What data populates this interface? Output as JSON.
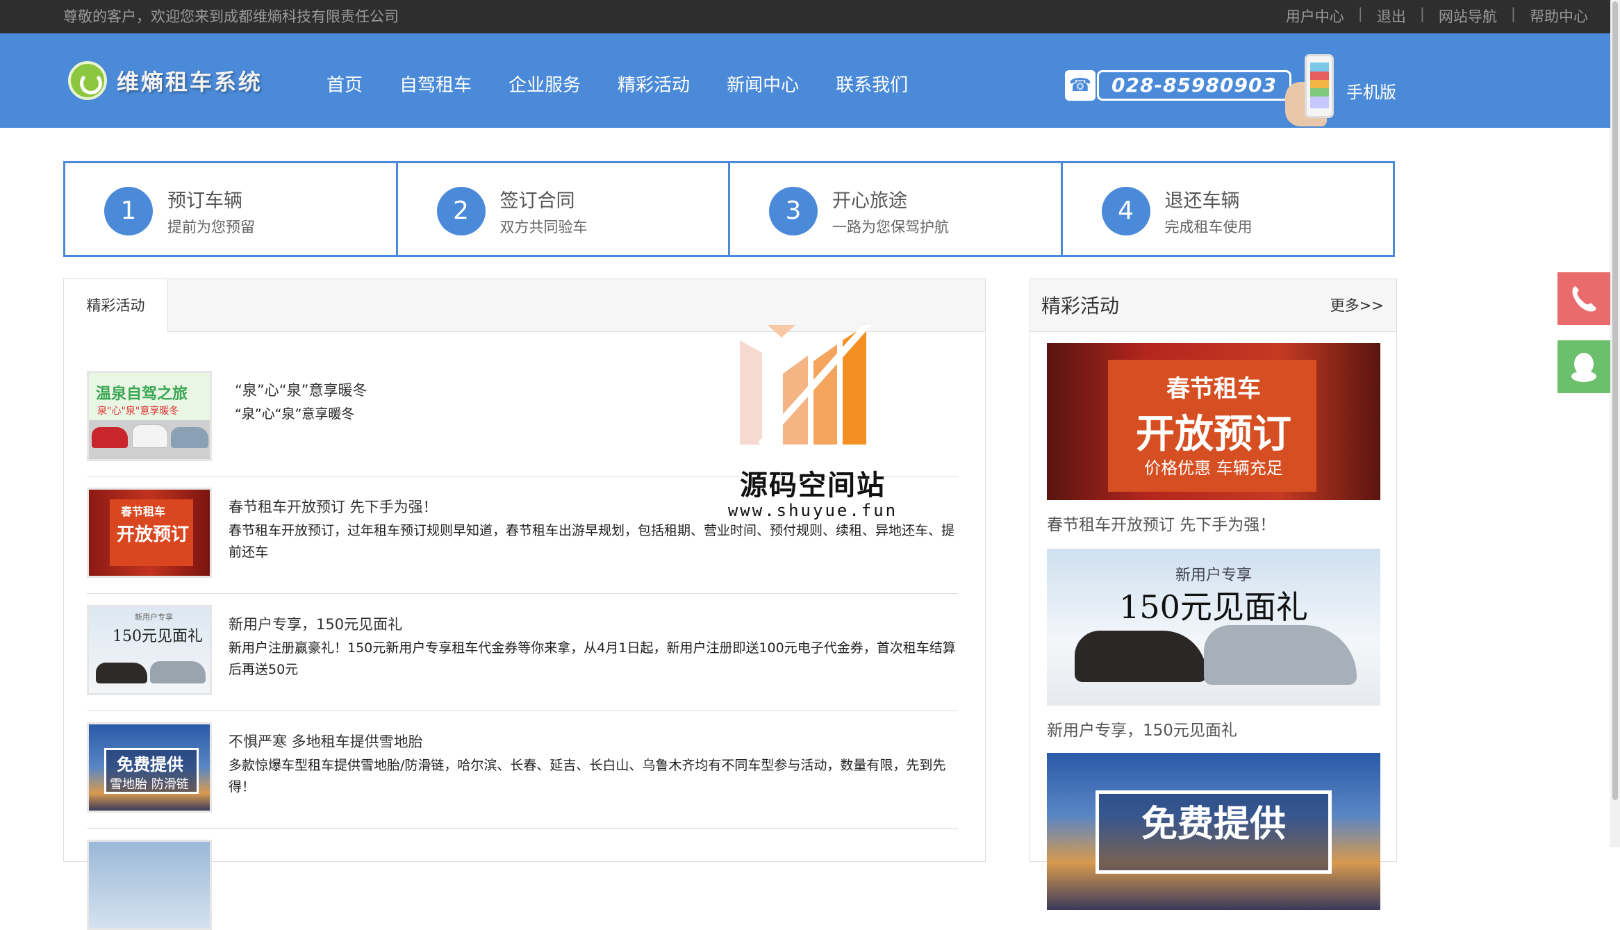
{
  "topbar": {
    "welcome": "尊敬的客户，欢迎您来到成都维熵科技有限责任公司",
    "links": [
      "用户中心",
      "退出",
      "网站导航",
      "帮助中心"
    ],
    "separator": "|"
  },
  "header": {
    "logo_text": "维熵租车系统",
    "nav": [
      "首页",
      "自驾租车",
      "企业服务",
      "精彩活动",
      "新闻中心",
      "联系我们"
    ],
    "phone": "028-85980903",
    "mobile_label": "手机版",
    "colors": {
      "brand": "#4a8ad8",
      "topbar": "#2e2e2e"
    }
  },
  "steps": [
    {
      "num": "1",
      "title": "预订车辆",
      "sub": "提前为您预留"
    },
    {
      "num": "2",
      "title": "签订合同",
      "sub": "双方共同验车"
    },
    {
      "num": "3",
      "title": "开心旅途",
      "sub": "一路为您保驾护航"
    },
    {
      "num": "4",
      "title": "退还车辆",
      "sub": "完成租车使用"
    }
  ],
  "main": {
    "tab": "精彩活动",
    "items": [
      {
        "thumb_text": "温泉自驾之旅",
        "thumb_sub": "泉\"心\"泉\"意享暖冬",
        "title": "“泉”心“泉”意享暖冬",
        "desc": "“泉”心“泉”意享暖冬"
      },
      {
        "thumb_text": "春节租车",
        "thumb_sub": "开放预订",
        "title": "春节租车开放预订 先下手为强！",
        "desc": "春节租车开放预订，过年租车预订规则早知道，春节租车出游早规划，包括租期、营业时间、预付规则、续租、异地还车、提前还车"
      },
      {
        "thumb_text": "新用户专享",
        "thumb_sub": "150元见面礼",
        "title": "新用户专享，150元见面礼",
        "desc": "新用户注册赢豪礼！150元新用户专享租车代金券等你来拿，从4月1日起，新用户注册即送100元电子代金券，首次租车结算后再送50元"
      },
      {
        "thumb_text": "免费提供",
        "thumb_sub": "雪地胎 防滑链",
        "title": "不惧严寒 多地租车提供雪地胎",
        "desc": "多款惊爆车型租车提供雪地胎/防滑链，哈尔滨、长春、延吉、长白山、乌鲁木齐均有不同车型参与活动，数量有限，先到先得！"
      }
    ]
  },
  "watermark": {
    "cn": "源码空间站",
    "en": "www.shuyue.fun"
  },
  "side": {
    "title": "精彩活动",
    "more": "更多>>",
    "cards": [
      {
        "l1": "春节租车",
        "l2": "开放预订",
        "l3": "价格优惠 车辆充足",
        "caption": "春节租车开放预订 先下手为强！"
      },
      {
        "l1": "新用户专享",
        "l2": "150元见面礼",
        "caption": "新用户专享，150元见面礼"
      },
      {
        "l1": "免费提供",
        "caption": ""
      }
    ]
  },
  "float": {
    "phone_color": "#e96b6b",
    "qq_color": "#6cbf6c"
  }
}
